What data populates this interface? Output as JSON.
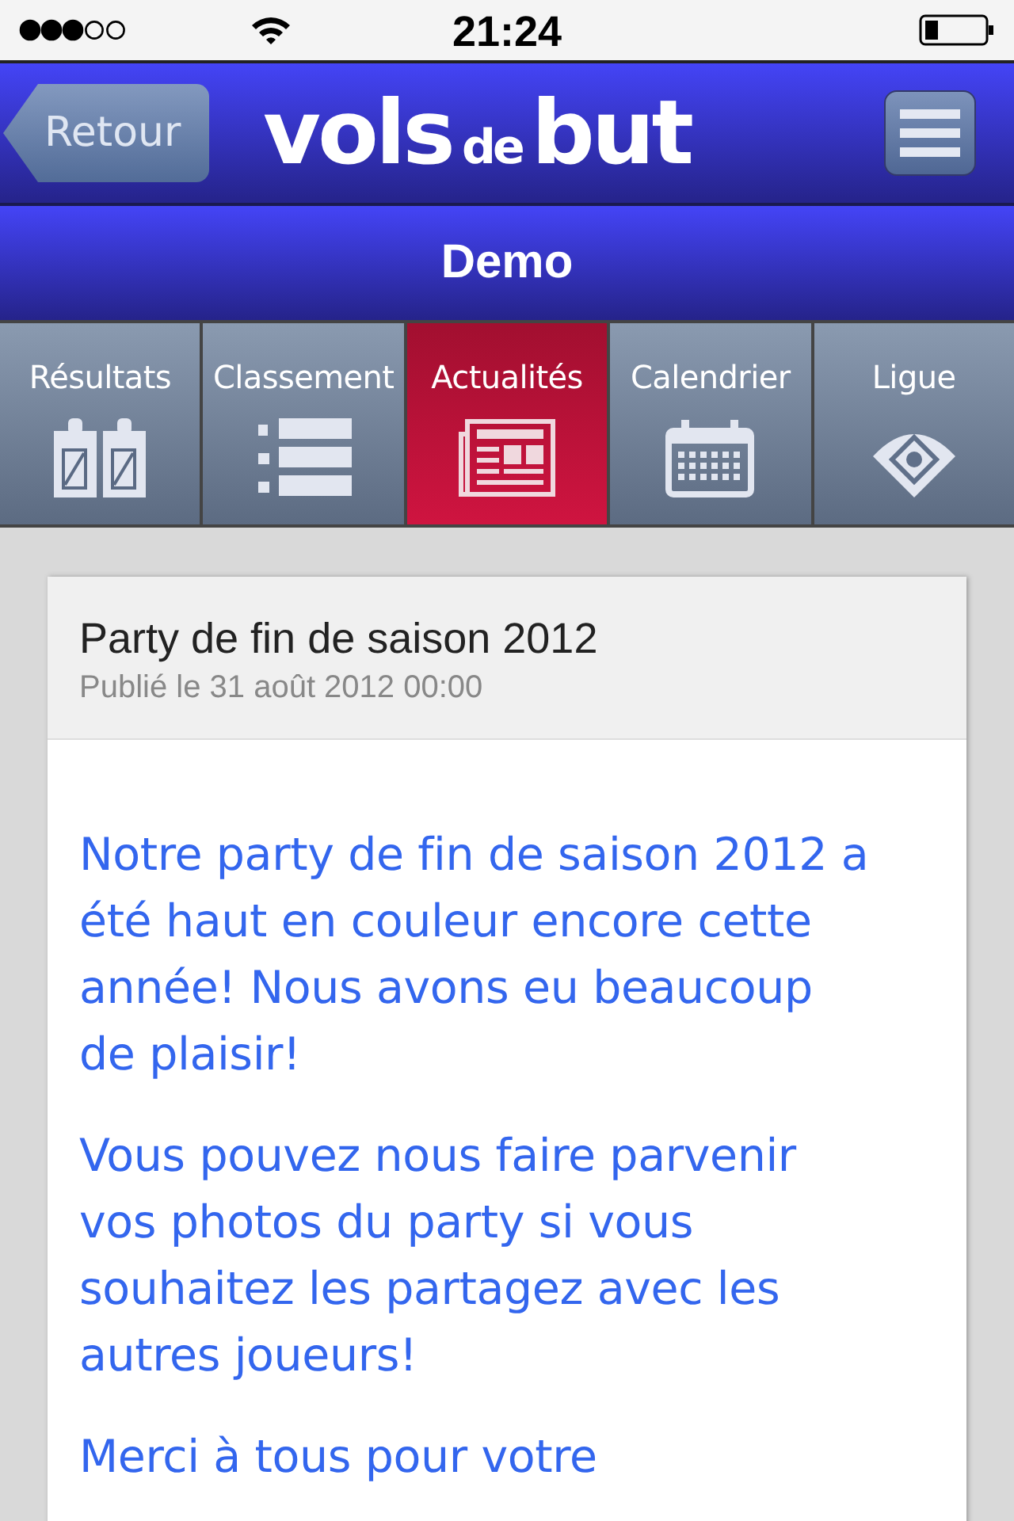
{
  "status_bar": {
    "time": "21:24"
  },
  "header": {
    "back_button": "Retour",
    "logo": [
      "vols",
      "de",
      "but"
    ]
  },
  "title_bar": {
    "title": "Demo"
  },
  "tabs": [
    {
      "label": "Résultats",
      "kind": "scores",
      "selected": false
    },
    {
      "label": "Classement",
      "kind": "ranking",
      "selected": false
    },
    {
      "label": "Actualités",
      "kind": "news",
      "selected": true
    },
    {
      "label": "Calendrier",
      "kind": "calendar",
      "selected": false
    },
    {
      "label": "Ligue",
      "kind": "field",
      "selected": false
    }
  ],
  "article": {
    "title": "Party de fin de saison 2012",
    "published": "Publié le 31 août 2012 00:00",
    "paragraphs": [
      "Notre party de fin de saison 2012 a été haut en couleur encore cette année! Nous avons eu beaucoup de plaisir!",
      "Vous pouvez nous faire parvenir vos photos du party si vous souhaitez les partagez avec les autres joueurs!",
      "Merci à tous pour votre"
    ]
  }
}
